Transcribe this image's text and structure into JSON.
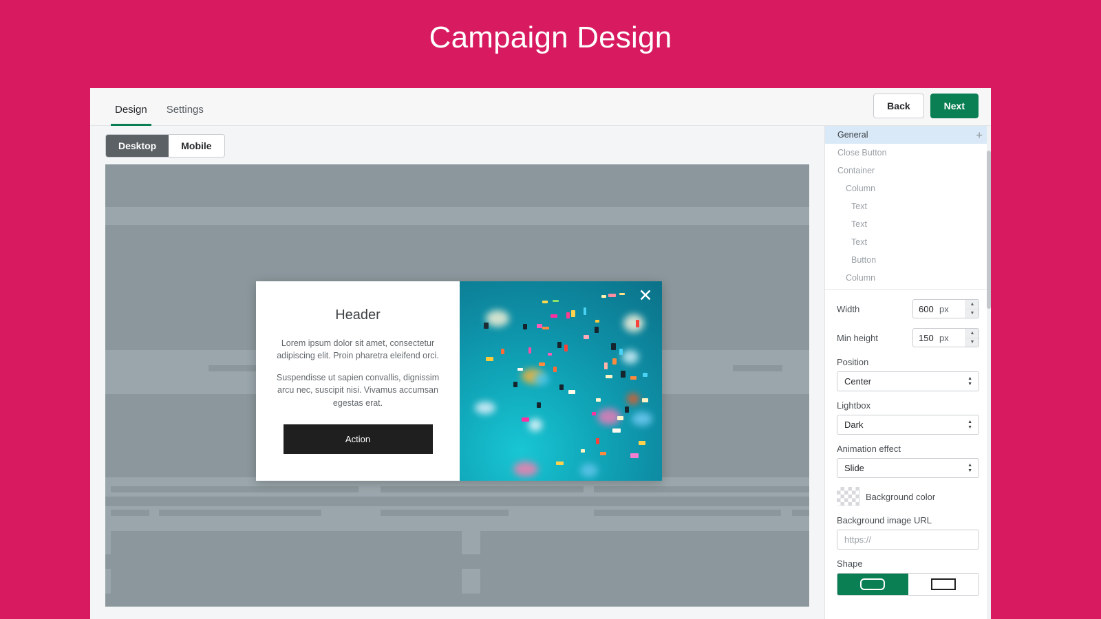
{
  "page": {
    "title": "Campaign Design",
    "brand_color": "#d81b60",
    "accent_color": "#0a7f53"
  },
  "topbar": {
    "tabs": [
      {
        "label": "Design",
        "active": true
      },
      {
        "label": "Settings",
        "active": false
      }
    ],
    "back_label": "Back",
    "next_label": "Next"
  },
  "device_toggle": {
    "options": [
      {
        "label": "Desktop",
        "active": true
      },
      {
        "label": "Mobile",
        "active": false
      }
    ]
  },
  "modal": {
    "header": "Header",
    "paragraph1": "Lorem ipsum dolor sit amet, consectetur adipiscing elit. Proin pharetra eleifend orci.",
    "paragraph2": "Suspendisse ut sapien convallis, dignissim arcu nec, suscipit nisi. Vivamus accumsan egestas erat.",
    "action_label": "Action",
    "close_icon": "close-icon"
  },
  "panel": {
    "tree": [
      {
        "label": "General",
        "depth": 1,
        "selected": true,
        "add_icon": "plus-icon"
      },
      {
        "label": "Close Button",
        "depth": 1,
        "selected": false
      },
      {
        "label": "Container",
        "depth": 1,
        "selected": false
      },
      {
        "label": "Column",
        "depth": 2,
        "selected": false
      },
      {
        "label": "Text",
        "depth": 3,
        "selected": false
      },
      {
        "label": "Text",
        "depth": 3,
        "selected": false
      },
      {
        "label": "Text",
        "depth": 3,
        "selected": false
      },
      {
        "label": "Button",
        "depth": 3,
        "selected": false
      },
      {
        "label": "Column",
        "depth": 2,
        "selected": false
      }
    ],
    "width": {
      "label": "Width",
      "value": "600",
      "unit": "px"
    },
    "min_height": {
      "label": "Min height",
      "value": "150",
      "unit": "px"
    },
    "position": {
      "label": "Position",
      "value": "Center"
    },
    "lightbox": {
      "label": "Lightbox",
      "value": "Dark"
    },
    "animation": {
      "label": "Animation effect",
      "value": "Slide"
    },
    "background_color": {
      "label": "Background color"
    },
    "background_image": {
      "label": "Background image URL",
      "value": "",
      "placeholder": "https://"
    },
    "shape": {
      "label": "Shape",
      "options": [
        {
          "icon": "rounded-rectangle-icon",
          "active": true
        },
        {
          "icon": "square-rectangle-icon",
          "active": false
        }
      ]
    }
  }
}
